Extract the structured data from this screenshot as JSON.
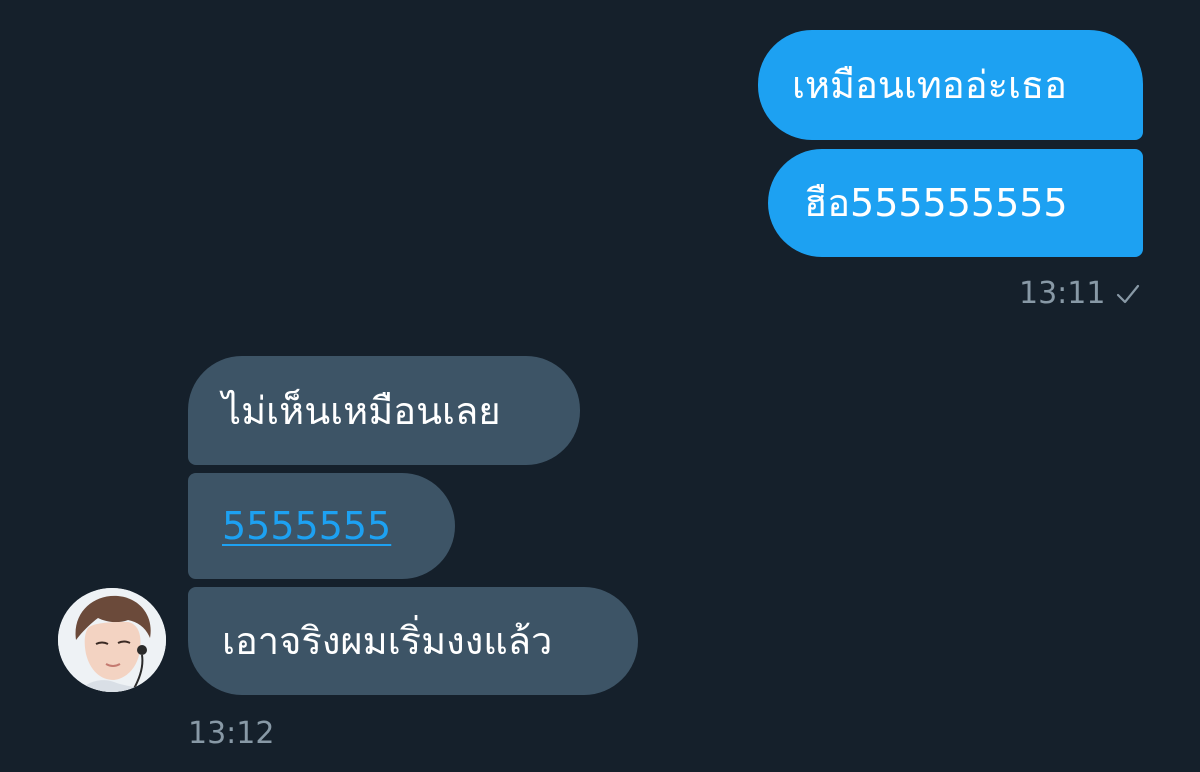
{
  "messages": {
    "outgoing": [
      "เหมือนเทออ่ะเธอ",
      "ฮือ555555555"
    ],
    "outgoing_time": "13:11",
    "incoming": [
      "ไม่เห็นเหมือนเลย",
      "5555555",
      "เอาจริงผมเริ่มงงแล้ว"
    ],
    "incoming_time": "13:12"
  },
  "icons": {
    "read_receipt": "check-icon",
    "sender_avatar": "avatar"
  },
  "colors": {
    "background": "#15202b",
    "outgoing_bubble": "#1da1f2",
    "incoming_bubble": "#3d5466",
    "link": "#1da1f2",
    "timestamp": "#8899a6"
  }
}
